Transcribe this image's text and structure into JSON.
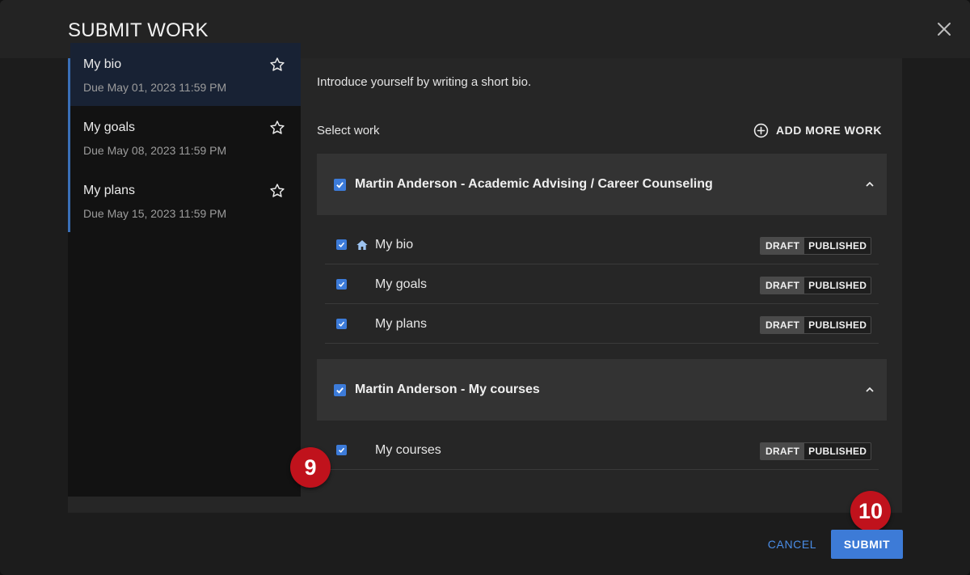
{
  "dialog": {
    "title": "SUBMIT WORK"
  },
  "sidebar": {
    "items": [
      {
        "label": "My bio",
        "due": "Due May 01, 2023 11:59 PM"
      },
      {
        "label": "My goals",
        "due": "Due May 08, 2023 11:59 PM"
      },
      {
        "label": "My plans",
        "due": "Due May 15, 2023 11:59 PM"
      }
    ]
  },
  "main": {
    "intro": "Introduce yourself by writing a short bio.",
    "select_label": "Select work",
    "add_more_label": "ADD MORE WORK",
    "groups": [
      {
        "title": "Martin Anderson - Academic Advising / Career Counseling",
        "items": [
          {
            "name": "My bio",
            "draft": "DRAFT",
            "published": "PUBLISHED"
          },
          {
            "name": "My goals",
            "draft": "DRAFT",
            "published": "PUBLISHED"
          },
          {
            "name": "My plans",
            "draft": "DRAFT",
            "published": "PUBLISHED"
          }
        ]
      },
      {
        "title": "Martin Anderson - My courses",
        "items": [
          {
            "name": "My courses",
            "draft": "DRAFT",
            "published": "PUBLISHED"
          }
        ]
      }
    ]
  },
  "markers": {
    "first": "9",
    "second": "10"
  },
  "actions": {
    "cancel": "CANCEL",
    "submit": "SUBMIT"
  },
  "colors": {
    "accent": "#3d7bd7",
    "marker": "#c0121c",
    "active_item_bg": "#182234"
  },
  "icons": {
    "close": "close-icon",
    "star": "star-outline-icon",
    "add": "add-circle-icon",
    "chevron": "chevron-up-icon",
    "home": "home-icon",
    "checkbox": "checkbox-checked-icon"
  }
}
